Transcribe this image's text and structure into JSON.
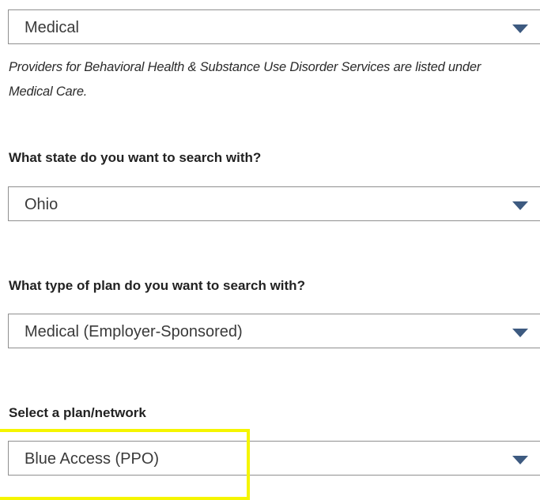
{
  "care_type": {
    "selected": "Medical",
    "note": "Providers for Behavioral Health & Substance Use Disorder Services are listed under Medical Care."
  },
  "state": {
    "question": "What state do you want to search with?",
    "selected": "Ohio"
  },
  "plan_type": {
    "question": "What type of plan do you want to search with?",
    "selected": "Medical (Employer-Sponsored)"
  },
  "plan_network": {
    "question": "Select a plan/network",
    "selected": "Blue Access (PPO)"
  },
  "colors": {
    "chevron": "#3d5a80",
    "highlight": "#f5f500",
    "border": "#8f8f8f"
  },
  "icons": {
    "dropdown": "chevron-down-icon"
  }
}
